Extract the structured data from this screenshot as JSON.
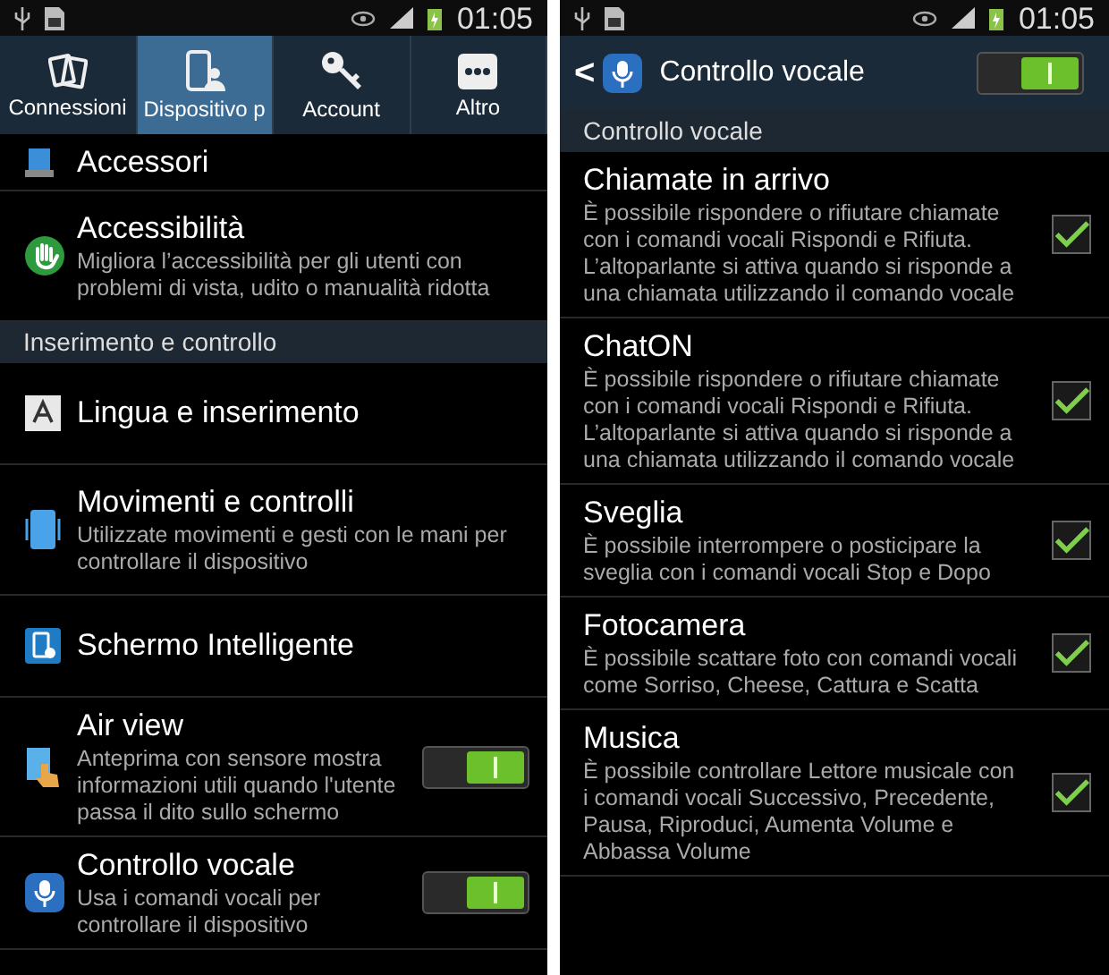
{
  "left_screen": {
    "status_bar": {
      "time": "01:05"
    },
    "tabs": [
      {
        "label": "Connessioni",
        "selected": false
      },
      {
        "label": "Dispositivo p",
        "selected": true
      },
      {
        "label": "Account",
        "selected": false
      },
      {
        "label": "Altro",
        "selected": false
      }
    ],
    "items": [
      {
        "kind": "item",
        "title": "Accessori"
      },
      {
        "kind": "item",
        "title": "Accessibilità",
        "description": "Migliora l’accessibilità per gli utenti con problemi di vista, udito o manualità ridotta"
      },
      {
        "kind": "section",
        "title": "Inserimento e controllo"
      },
      {
        "kind": "item",
        "title": "Lingua e inserimento"
      },
      {
        "kind": "item",
        "title": "Movimenti e controlli",
        "description": "Utilizzate movimenti e gesti con le mani per controllare il dispositivo"
      },
      {
        "kind": "item",
        "title": "Schermo Intelligente"
      },
      {
        "kind": "item",
        "title": "Air view",
        "description": "Anteprima con sensore mostra informazioni utili quando l'utente passa il dito sullo schermo",
        "toggle": {
          "on": true
        }
      },
      {
        "kind": "item",
        "title": "Controllo vocale",
        "description": "Usa i comandi vocali per controllare il dispositivo",
        "toggle": {
          "on": true
        }
      }
    ]
  },
  "right_screen": {
    "status_bar": {
      "time": "01:05"
    },
    "header": {
      "back": "<",
      "title": "Controllo vocale",
      "switch_on": true
    },
    "section": "Controllo vocale",
    "options": [
      {
        "title": "Chiamate in arrivo",
        "description": "È possibile rispondere o rifiutare chiamate con i comandi vocali Rispondi e Rifiuta. L’altoparlante si attiva quando si risponde a una chiamata utilizzando il comando vocale",
        "checked": true
      },
      {
        "title": "ChatON",
        "description": "È possibile rispondere o rifiutare chiamate con i comandi vocali Rispondi e Rifiuta. L’altoparlante si attiva quando si risponde a una chiamata utilizzando il comando vocale",
        "checked": true
      },
      {
        "title": "Sveglia",
        "description": "È possibile interrompere o posticipare la sveglia con i comandi vocali Stop e Dopo",
        "checked": true
      },
      {
        "title": "Fotocamera",
        "description": "È possibile scattare foto con comandi vocali come Sorriso, Cheese, Cattura e Scatta",
        "checked": true
      },
      {
        "title": "Musica",
        "description": "È possibile controllare Lettore musicale con i comandi vocali Successivo, Precedente, Pausa, Riproduci, Aumenta Volume e Abbassa Volume",
        "checked": true
      }
    ]
  }
}
